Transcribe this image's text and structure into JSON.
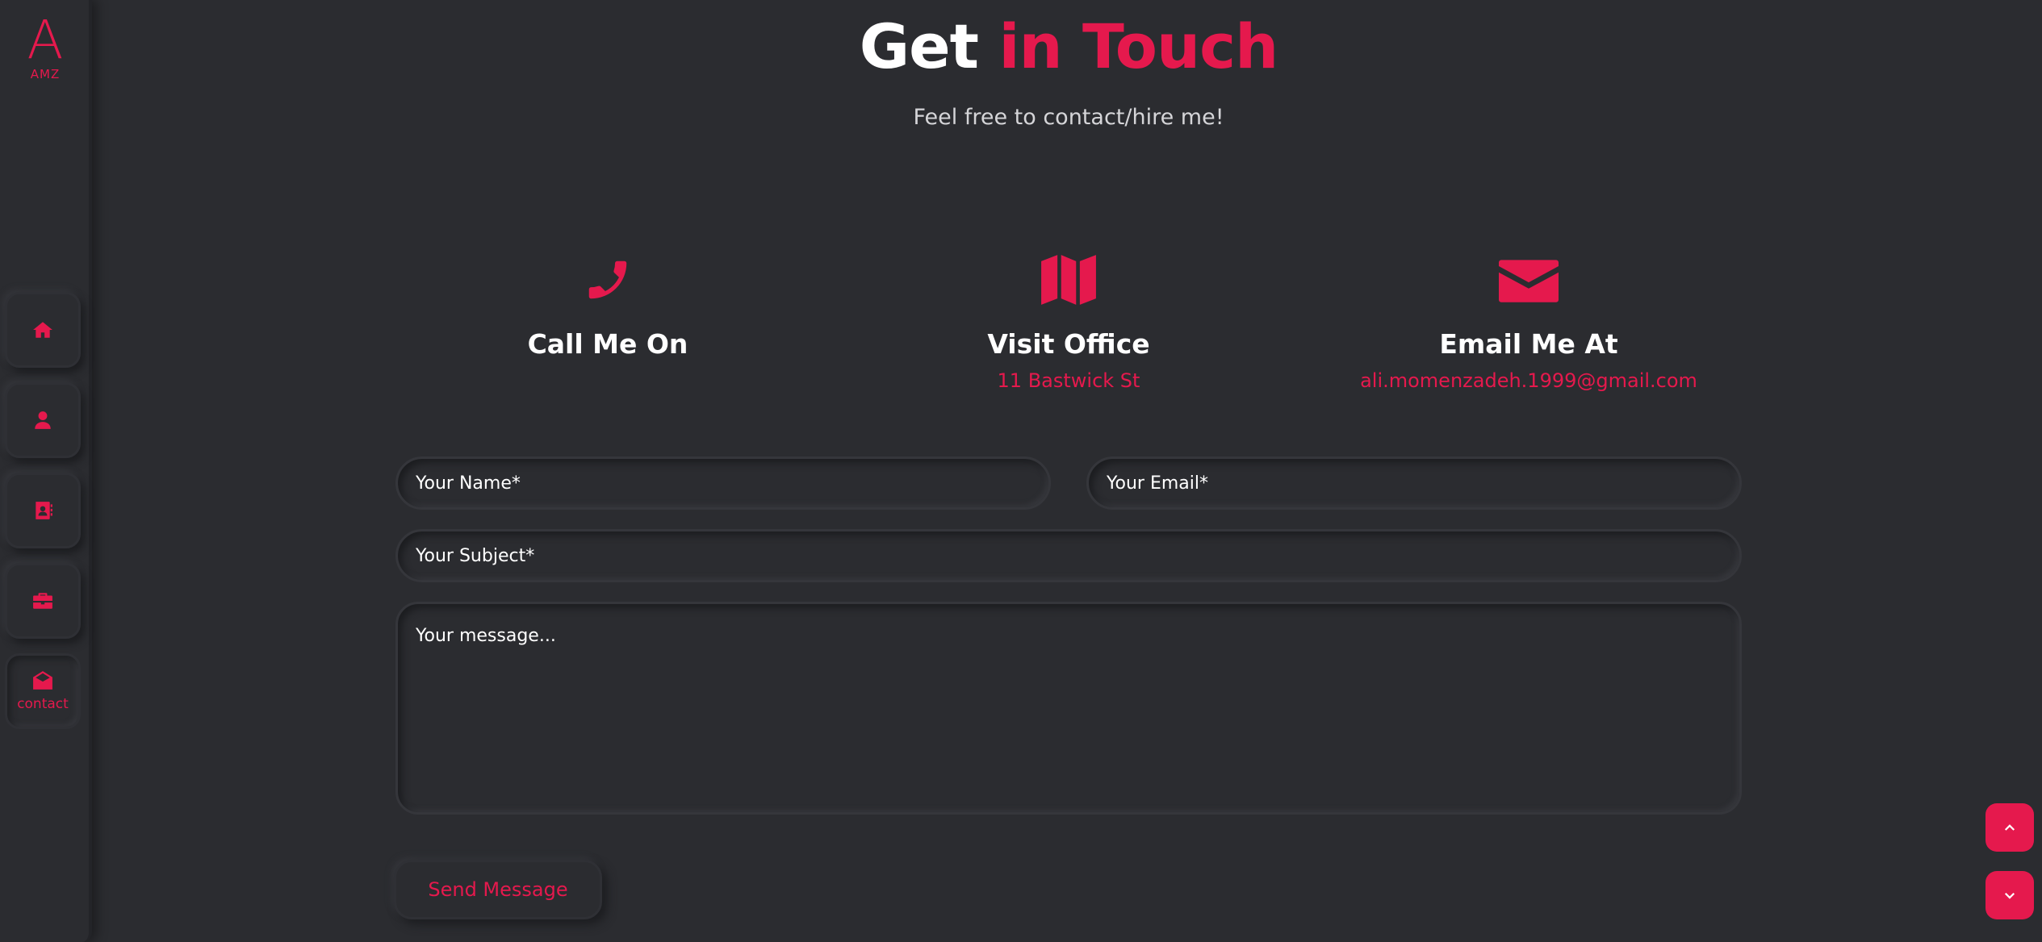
{
  "sidebar": {
    "logo_letter": "A",
    "logo_text": "AMZ",
    "items": [
      {
        "icon": "home-icon"
      },
      {
        "icon": "user-icon"
      },
      {
        "icon": "address-book-icon"
      },
      {
        "icon": "briefcase-icon"
      },
      {
        "icon": "envelope-open-icon",
        "label": "contact",
        "active": true
      }
    ]
  },
  "header": {
    "title_part1": "Get",
    "title_part2": "in Touch",
    "subtitle": "Feel free to contact/hire me!"
  },
  "info": [
    {
      "icon": "phone-icon",
      "label": "Call Me On",
      "value": ""
    },
    {
      "icon": "map-icon",
      "label": "Visit Office",
      "value": "11 Bastwick St"
    },
    {
      "icon": "envelope-icon",
      "label": "Email Me At",
      "value": "ali.momenzadeh.1999@gmail.com"
    }
  ],
  "form": {
    "name_placeholder": "Your Name*",
    "email_placeholder": "Your Email*",
    "subject_placeholder": "Your Subject*",
    "message_placeholder": "Your message...",
    "send_label": "Send Message"
  },
  "scroll": {
    "up_icon": "chevron-up-icon",
    "down_icon": "chevron-down-icon"
  },
  "colors": {
    "accent": "#e5194d",
    "background": "#2b2c30"
  }
}
